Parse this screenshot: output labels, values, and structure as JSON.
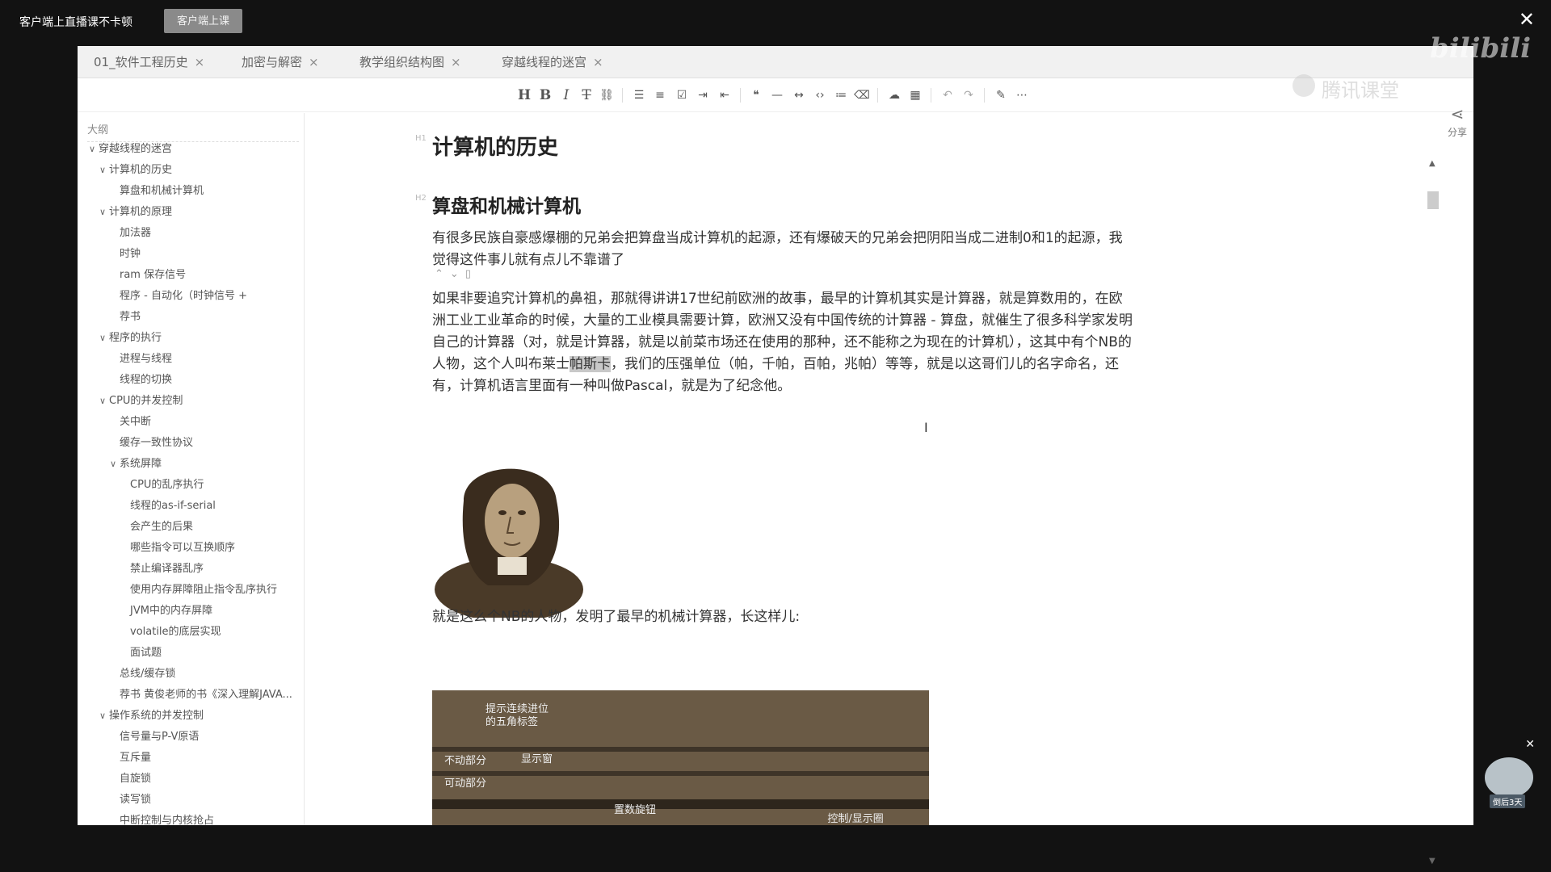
{
  "topbar": {
    "hint": "客户端上直播课不卡顿",
    "client_button": "客户端上课",
    "brand_bili": "bilibili",
    "brand_ketang": "腾讯课堂"
  },
  "tabs": [
    {
      "label": "01_软件工程历史"
    },
    {
      "label": "加密与解密"
    },
    {
      "label": "教学组织结构图"
    },
    {
      "label": "穿越线程的迷宫"
    }
  ],
  "toolbar": {
    "icons": [
      "heading-icon",
      "bold-icon",
      "italic-icon",
      "strikethrough-icon",
      "link-icon",
      "bullet-list-icon",
      "ordered-list-icon",
      "checkbox-list-icon",
      "indent-icon",
      "outdent-icon",
      "quote-icon",
      "horizontal-rule-icon",
      "code-inline-icon",
      "code-block-icon",
      "format-icon",
      "clear-format-icon",
      "upload-icon",
      "table-icon",
      "undo-icon",
      "redo-icon",
      "pen-icon",
      "more-icon"
    ]
  },
  "share": {
    "label": "分享"
  },
  "outline": {
    "title": "大纲",
    "items": [
      {
        "label": "穿越线程的迷宫",
        "level": 0,
        "caret": true
      },
      {
        "label": "计算机的历史",
        "level": 1,
        "caret": true
      },
      {
        "label": "算盘和机械计算机",
        "level": 2,
        "caret": false
      },
      {
        "label": "计算机的原理",
        "level": 1,
        "caret": true
      },
      {
        "label": "加法器",
        "level": 2,
        "caret": false
      },
      {
        "label": "时钟",
        "level": 2,
        "caret": false
      },
      {
        "label": "ram 保存信号",
        "level": 2,
        "caret": false
      },
      {
        "label": "程序 - 自动化（时钟信号 +",
        "level": 2,
        "caret": false
      },
      {
        "label": "荐书",
        "level": 2,
        "caret": false
      },
      {
        "label": "程序的执行",
        "level": 1,
        "caret": true
      },
      {
        "label": "进程与线程",
        "level": 2,
        "caret": false
      },
      {
        "label": "线程的切换",
        "level": 2,
        "caret": false
      },
      {
        "label": "CPU的并发控制",
        "level": 1,
        "caret": true
      },
      {
        "label": "关中断",
        "level": 2,
        "caret": false
      },
      {
        "label": "缓存一致性协议",
        "level": 2,
        "caret": false
      },
      {
        "label": "系统屏障",
        "level": 2,
        "caret": true
      },
      {
        "label": "CPU的乱序执行",
        "level": 3,
        "caret": false
      },
      {
        "label": "线程的as-if-serial",
        "level": 3,
        "caret": false
      },
      {
        "label": "会产生的后果",
        "level": 3,
        "caret": false
      },
      {
        "label": "哪些指令可以互换顺序",
        "level": 3,
        "caret": false
      },
      {
        "label": "禁止编译器乱序",
        "level": 3,
        "caret": false
      },
      {
        "label": "使用内存屏障阻止指令乱序执行",
        "level": 3,
        "caret": false
      },
      {
        "label": "JVM中的内存屏障",
        "level": 3,
        "caret": false
      },
      {
        "label": "volatile的底层实现",
        "level": 3,
        "caret": false
      },
      {
        "label": "面试题",
        "level": 3,
        "caret": false
      },
      {
        "label": "总线/缓存锁",
        "level": 2,
        "caret": false
      },
      {
        "label": "荐书 黄俊老师的书《深入理解JAVA...",
        "level": 2,
        "caret": false
      },
      {
        "label": "操作系统的并发控制",
        "level": 1,
        "caret": true
      },
      {
        "label": "信号量与P-V原语",
        "level": 2,
        "caret": false
      },
      {
        "label": "互斥量",
        "level": 2,
        "caret": false
      },
      {
        "label": "自旋锁",
        "level": 2,
        "caret": false
      },
      {
        "label": "读写锁",
        "level": 2,
        "caret": false
      },
      {
        "label": "中断控制与内核抢占",
        "level": 2,
        "caret": false
      }
    ]
  },
  "doc": {
    "h1": "计算机的历史",
    "h2": "算盘和机械计算机",
    "p1": "有很多民族自豪感爆棚的兄弟会把算盘当成计算机的起源，还有爆破天的兄弟会把阴阳当成二进制0和1的起源，我觉得这件事儿就有点儿不靠谱了",
    "p2_before": "如果非要追究计算机的鼻祖，那就得讲讲17世纪前欧洲的故事，最早的计算机其实是计算器，就是算数用的，在欧洲工业工业革命的时候，大量的工业模具需要计算，欧洲又没有中国传统的计算器 - 算盘，就催生了很多科学家发明自己的计算器（对，就是计算器，就是以前菜市场还在使用的那种，还不能称之为现在的计算机），这其中有个NB的人物，这个人叫布莱士",
    "p2_highlight": "帕斯卡",
    "p2_after": "，我们的压强单位（帕，千帕，百帕，兆帕）等等，就是以这哥们儿的名字命名，还有，计算机语言里面有一种叫做Pascal，就是为了纪念他。",
    "p3": "就是这么个NB的人物，发明了最早的机械计算器，长这样儿:",
    "machine_labels": {
      "carry": "提示连续进位\n的五角标签",
      "fixed": "不动部分",
      "movable": "可动部分",
      "display": "显示窗",
      "dial": "置数旋钮",
      "control": "控制/显示圈\n数的大刻度盘"
    }
  },
  "widget": {
    "tag": "倒后3天"
  }
}
